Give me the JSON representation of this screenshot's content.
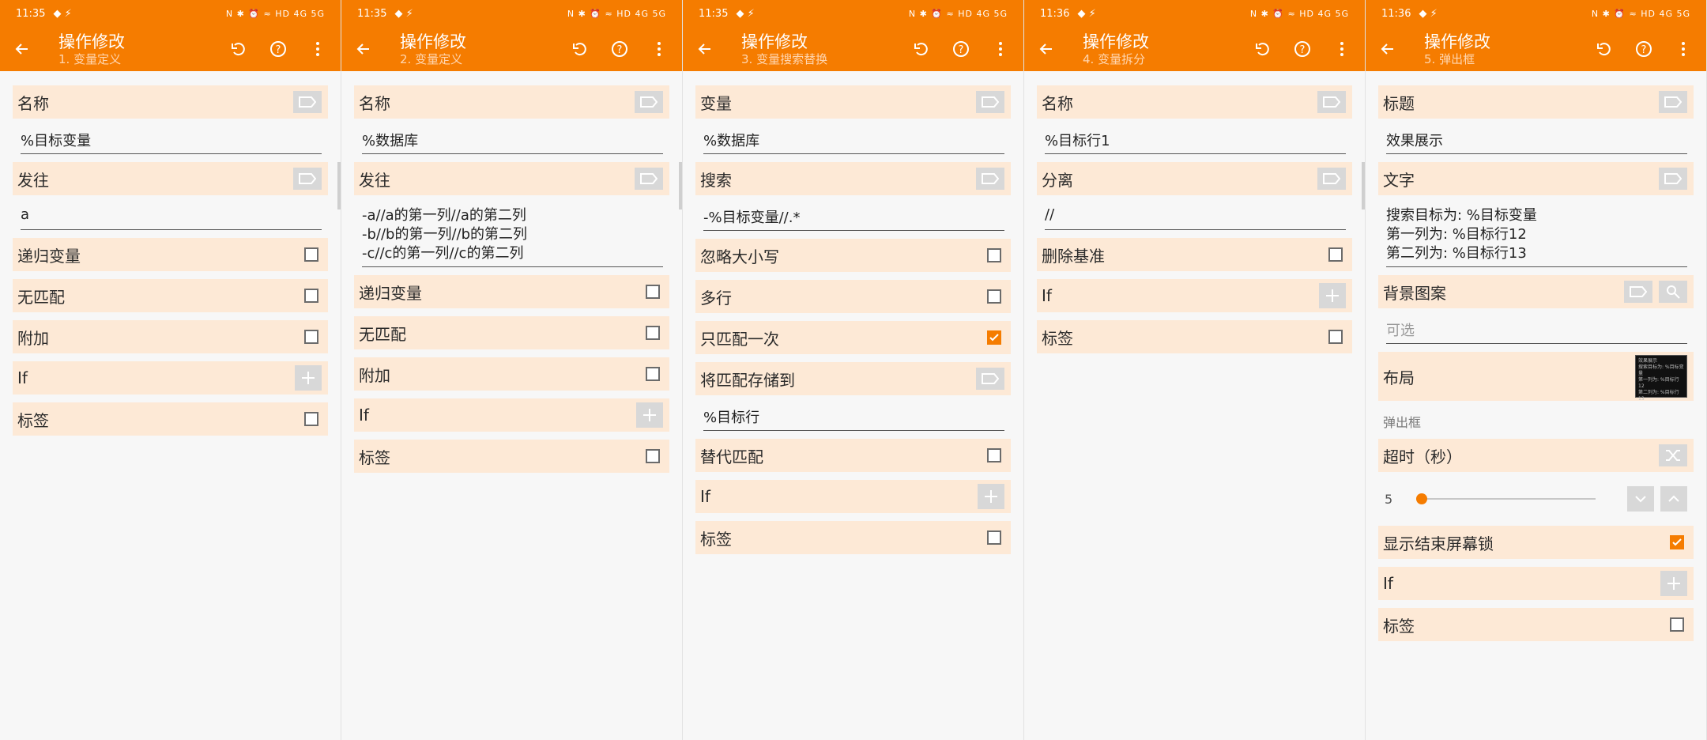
{
  "colors": {
    "accent": "#f57c00",
    "row_bg": "#fde9d6",
    "checked": "#f57c00"
  },
  "panels": [
    {
      "time": "11:35",
      "status_icons": "N ✱ ⏰ ≈ HD 4G 5G",
      "title": "操作修改",
      "subtitle": "1. 变量定义",
      "rows": {
        "r1": "名称",
        "r1_value": "%目标变量",
        "r2": "发往",
        "r2_value": "a",
        "r3": "递归变量",
        "r4": "无匹配",
        "r5": "附加",
        "r6": "If",
        "r7": "标签"
      }
    },
    {
      "time": "11:35",
      "status_icons": "N ✱ ⏰ ≈ HD 4G 5G",
      "title": "操作修改",
      "subtitle": "2. 变量定义",
      "rows": {
        "r1": "名称",
        "r1_value": "%数据库",
        "r2": "发往",
        "r2_lines": [
          "-a//a的第一列//a的第二列",
          "-b//b的第一列//b的第二列",
          "-c//c的第一列//c的第二列"
        ],
        "r3": "递归变量",
        "r4": "无匹配",
        "r5": "附加",
        "r6": "If",
        "r7": "标签"
      }
    },
    {
      "time": "11:35",
      "status_icons": "N ✱ ⏰ ≈ HD 4G 5G",
      "title": "操作修改",
      "subtitle": "3. 变量搜索替换",
      "rows": {
        "r1": "变量",
        "r1_value": "%数据库",
        "r2": "搜索",
        "r2_value": "-%目标变量//.*",
        "r3": "忽略大小写",
        "r4": "多行",
        "r5": "只匹配一次",
        "r6": "将匹配存储到",
        "r6_value": "%目标行",
        "r7": "替代匹配",
        "r8": "If",
        "r9": "标签"
      }
    },
    {
      "time": "11:36",
      "status_icons": "N ✱ ⏰ ≈ HD 4G 5G",
      "title": "操作修改",
      "subtitle": "4. 变量拆分",
      "rows": {
        "r1": "名称",
        "r1_value": "%目标行1",
        "r2": "分离",
        "r2_value": "//",
        "r3": "删除基准",
        "r4": "If",
        "r5": "标签"
      }
    },
    {
      "time": "11:36",
      "status_icons": "N ✱ ⏰ ≈ HD 4G 5G",
      "title": "操作修改",
      "subtitle": "5. 弹出框",
      "rows": {
        "r1": "标题",
        "r1_value": "效果展示",
        "r2": "文字",
        "r2_lines": [
          "搜索目标为: %目标变量",
          "第一列为: %目标行12",
          "第二列为: %目标行13"
        ],
        "r3": "背景图案",
        "r3_placeholder": "可选",
        "r4": "布局",
        "thumb_lines": [
          "效果展示",
          "搜索目标为: %目标变量",
          "第一列为: %目标行12",
          "第二列为: %目标行13"
        ],
        "section": "弹出框",
        "r5": "超时（秒）",
        "timeout_value": "5",
        "r6": "显示结束屏幕锁",
        "r7": "If",
        "r8": "标签"
      }
    }
  ]
}
